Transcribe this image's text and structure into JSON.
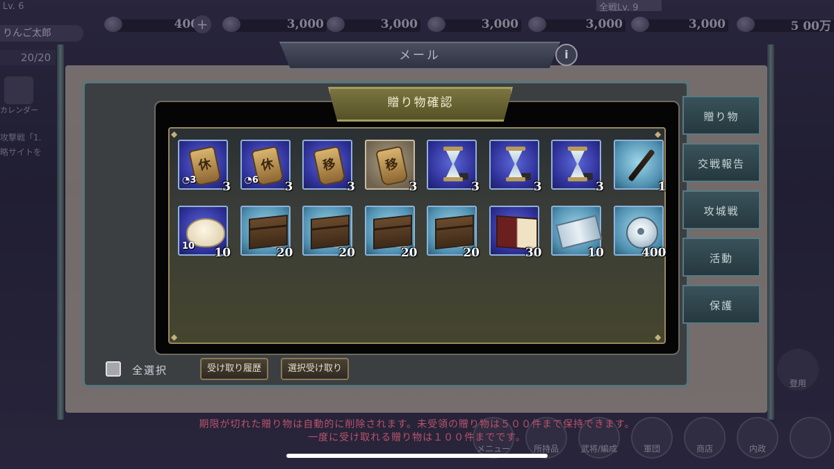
{
  "hud": {
    "player_level": "Lv. 6",
    "player_name": "りんご太郎",
    "stamina": "20/20",
    "right_level": "全戦Lv. 9",
    "resources": [
      {
        "icon": "coin-icon",
        "value": "400"
      },
      {
        "icon": "rice-icon",
        "value": "3,000"
      },
      {
        "icon": "wood-icon",
        "value": "3,000"
      },
      {
        "icon": "stone-icon",
        "value": "3,000"
      },
      {
        "icon": "iron-icon",
        "value": "3,000"
      },
      {
        "icon": "gold-icon",
        "value": "3,000"
      },
      {
        "icon": "troop-icon",
        "value": "5 00万"
      }
    ],
    "left_calendar_label": "カレンダー",
    "left_text_lines": [
      "攻撃戦「1.",
      "略サイトを"
    ]
  },
  "mail": {
    "title": "メール",
    "info_symbol": "i",
    "side_tabs": [
      "贈り物",
      "交戦報告",
      "攻城戦",
      "活動",
      "保護"
    ],
    "select_all_label": "全選択",
    "history_button": "受け取り履歴",
    "receive_selected_button": "選択受け取り"
  },
  "gift_dialog": {
    "title": "贈り物確認",
    "items": [
      {
        "kind": "tag",
        "glyph": "休",
        "sub": "3",
        "qty": "3",
        "rarity": "blue"
      },
      {
        "kind": "tag",
        "glyph": "休",
        "sub": "6",
        "qty": "3",
        "rarity": "blue"
      },
      {
        "kind": "tag",
        "glyph": "移",
        "sub": "",
        "qty": "3",
        "rarity": "blue"
      },
      {
        "kind": "tag",
        "glyph": "移",
        "sub": "",
        "qty": "3",
        "rarity": "brown"
      },
      {
        "kind": "hourglass",
        "glyph": "",
        "sub": "",
        "qty": "3",
        "rarity": "blue"
      },
      {
        "kind": "hourglass",
        "glyph": "",
        "sub": "",
        "qty": "3",
        "rarity": "blue"
      },
      {
        "kind": "hourglass",
        "glyph": "",
        "sub": "",
        "qty": "3",
        "rarity": "blue"
      },
      {
        "kind": "brush",
        "glyph": "",
        "sub": "",
        "qty": "1",
        "rarity": "cyan"
      },
      {
        "kind": "bun",
        "glyph": "",
        "sub": "10",
        "qty": "10",
        "rarity": "blue"
      },
      {
        "kind": "crate",
        "glyph": "",
        "sub": "",
        "qty": "20",
        "rarity": "cyan"
      },
      {
        "kind": "crate",
        "glyph": "",
        "sub": "",
        "qty": "20",
        "rarity": "cyan"
      },
      {
        "kind": "crate",
        "glyph": "",
        "sub": "",
        "qty": "20",
        "rarity": "cyan"
      },
      {
        "kind": "crate",
        "glyph": "",
        "sub": "",
        "qty": "20",
        "rarity": "cyan"
      },
      {
        "kind": "book",
        "glyph": "",
        "sub": "",
        "qty": "30",
        "rarity": "blue"
      },
      {
        "kind": "ticket",
        "glyph": "",
        "sub": "",
        "qty": "10",
        "rarity": "cyan"
      },
      {
        "kind": "coin",
        "glyph": "",
        "sub": "",
        "qty": "400",
        "rarity": "cyan"
      }
    ]
  },
  "notice": {
    "line1": "期限が切れた贈り物は自動的に削除されます。未受領の贈り物は５００件まで保持できます。",
    "line2": "一度に受け取れる贈り物は１００件までです。"
  },
  "bottom_nav": [
    "メニュー",
    "所持品",
    "武将/編成",
    "軍団",
    "商店",
    "内政"
  ],
  "right_edge_label": "登用",
  "colors": {
    "notice": "#b8536a",
    "gift_border": "#9b8a5b",
    "tab_bg": "#39525a"
  }
}
